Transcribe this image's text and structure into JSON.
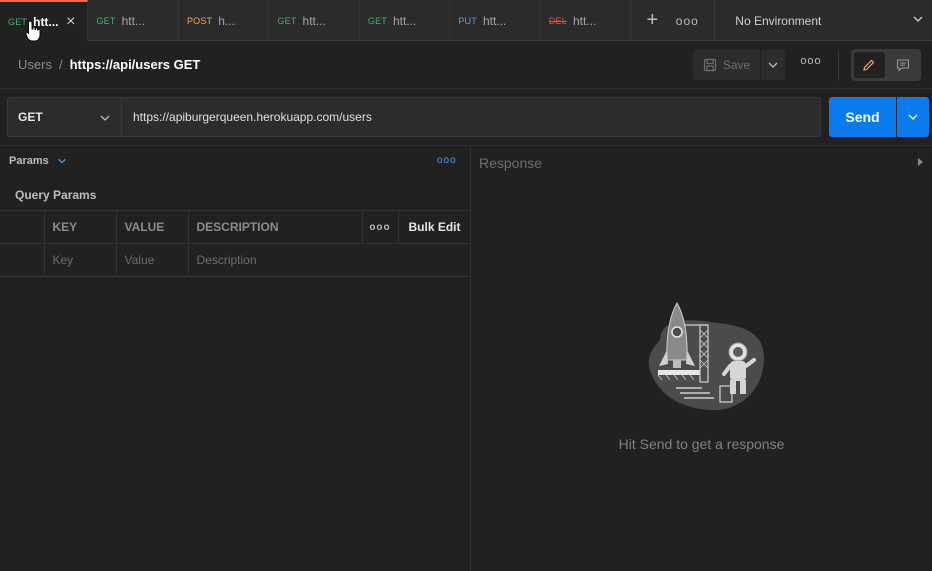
{
  "tabs": [
    {
      "method": "GET",
      "name": "htt...",
      "active": true
    },
    {
      "method": "GET",
      "name": "htt..."
    },
    {
      "method": "POST",
      "name": "h..."
    },
    {
      "method": "GET",
      "name": "htt..."
    },
    {
      "method": "GET",
      "name": "htt..."
    },
    {
      "method": "PUT",
      "name": "htt..."
    },
    {
      "method": "DEL",
      "name": "htt..."
    }
  ],
  "tabbar": {
    "plus": "+",
    "more": "ooo"
  },
  "environment": {
    "label": "No Environment"
  },
  "breadcrumb": {
    "parent": "Users",
    "separator": "/",
    "current": "https://api/users GET"
  },
  "toolbar": {
    "save_label": "Save",
    "more": "ooo"
  },
  "request": {
    "method": "GET",
    "url": "https://apiburgerqueen.herokuapp.com/users",
    "send_label": "Send"
  },
  "params": {
    "tab_label": "Params",
    "more": "ooo",
    "section_title": "Query Params",
    "headers": {
      "key": "KEY",
      "value": "VALUE",
      "description": "DESCRIPTION",
      "more": "ooo",
      "bulk_edit": "Bulk Edit"
    },
    "placeholders": {
      "key": "Key",
      "value": "Value",
      "description": "Description"
    }
  },
  "response": {
    "title": "Response",
    "empty_message": "Hit Send to get a response"
  },
  "colors": {
    "accent": "#097bed",
    "get": "#3fb467",
    "post": "#f4a84a",
    "put": "#4aa3f0",
    "delete": "#e0542f",
    "active_tab": "#f26b3a"
  }
}
